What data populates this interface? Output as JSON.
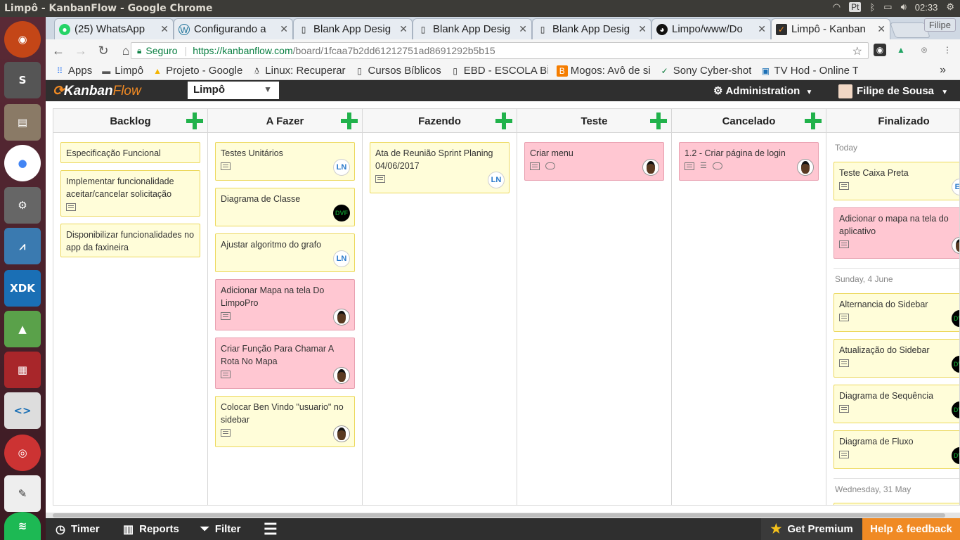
{
  "os": {
    "window_title": "Limpô - KanbanFlow - Google Chrome",
    "clock": "02:33",
    "keyboard": "Pt"
  },
  "launcher": {
    "items": [
      "ubuntu",
      "sublime-text",
      "files",
      "chrome",
      "settings",
      "system-monitor",
      "intel-xdk",
      "android-studio",
      "terminal-app",
      "code-editor",
      "disk-app",
      "text-editor",
      "spotify"
    ],
    "xdk_label": "XDK"
  },
  "browser": {
    "tabs": [
      {
        "label": "(25) WhatsApp",
        "icon": "whatsapp-icon"
      },
      {
        "label": "Configurando a",
        "icon": "wordpress-icon"
      },
      {
        "label": "Blank App Desig",
        "icon": "page-icon"
      },
      {
        "label": "Blank App Desig",
        "icon": "page-icon"
      },
      {
        "label": "Blank App Desig",
        "icon": "page-icon"
      },
      {
        "label": "Limpo/www/Do",
        "icon": "github-icon"
      },
      {
        "label": "Limpô - Kanban",
        "icon": "kanbanflow-icon"
      }
    ],
    "profile": "Filipe",
    "secure_label": "Seguro",
    "url_main": "https://kanbanflow.com",
    "url_rest": "/board/1fcaa7b2dd61212751ad8691292b5b15",
    "bookmarks": [
      {
        "label": "Apps",
        "icon": "apps-grid-icon"
      },
      {
        "label": "Limpô",
        "icon": "folder-icon"
      },
      {
        "label": "Projeto - Google",
        "icon": "google-drive-icon"
      },
      {
        "label": "Linux: Recuperar",
        "icon": "linux-icon"
      },
      {
        "label": "Cursos Bíblicos",
        "icon": "page-icon"
      },
      {
        "label": "EBD - ESCOLA BÍ",
        "icon": "page-icon"
      },
      {
        "label": "Mogos: Avô de si",
        "icon": "blogger-icon"
      },
      {
        "label": "Sony Cyber-shot",
        "icon": "sony-icon"
      },
      {
        "label": "TV Hod - Online T",
        "icon": "tv-icon"
      }
    ]
  },
  "kanbanflow": {
    "logo_kanban": "Kanban",
    "logo_flow": "Flow",
    "board_name": "Limpô",
    "admin_label": "Administration",
    "user_name": "Filipe de Sousa",
    "columns": [
      {
        "title": "Backlog",
        "tasks": [
          {
            "text": "Especificação Funcional"
          },
          {
            "text": "Implementar funcionalidade aceitar/cancelar solicitação"
          },
          {
            "text": "Disponibilizar funcionalidades no app da faxineira"
          }
        ]
      },
      {
        "title": "A Fazer",
        "tasks": [
          {
            "text": "Testes Unitários",
            "badge": "LN"
          },
          {
            "text": "Diagrama de Classe",
            "badge": "DVF"
          },
          {
            "text": "Ajustar algoritmo do grafo",
            "badge": "LN"
          },
          {
            "text": "Adicionar Mapa na tela Do LimpoPro"
          },
          {
            "text": "Criar Função Para Chamar A Rota No Mapa"
          },
          {
            "text": "Colocar Ben Vindo \"usuario\" no sidebar"
          }
        ]
      },
      {
        "title": "Fazendo",
        "tasks": [
          {
            "text": "Ata de Reunião Sprint Planing 04/06/2017",
            "badge": "LN"
          }
        ]
      },
      {
        "title": "Teste",
        "tasks": [
          {
            "text": "Criar menu"
          }
        ]
      },
      {
        "title": "Cancelado",
        "tasks": [
          {
            "text": "1.2 - Criar página de login"
          }
        ]
      },
      {
        "title": "Finalizado",
        "days": [
          "Today",
          "Sunday, 4 June",
          "Wednesday, 31 May"
        ],
        "tasks": [
          {
            "text": "Teste Caixa Preta",
            "badge": "ES"
          },
          {
            "text": "Adicionar o mapa na tela do aplicativo"
          },
          {
            "text": "Alternancia do Sidebar",
            "badge": "DVF"
          },
          {
            "text": "Atualização do Sidebar",
            "badge": "DVF"
          },
          {
            "text": "Diagrama de Sequência",
            "badge": "DVF"
          },
          {
            "text": "Diagrama de Fluxo",
            "badge": "DVF"
          }
        ]
      }
    ],
    "bottom": {
      "timer": "Timer",
      "reports": "Reports",
      "filter": "Filter",
      "premium": "Get Premium",
      "help": "Help & feedback"
    },
    "colors": {
      "yellow_card": "#fffdd9",
      "pink_card": "#ffc7d2",
      "green_plus": "#21b24b",
      "orange": "#f08a24"
    }
  }
}
